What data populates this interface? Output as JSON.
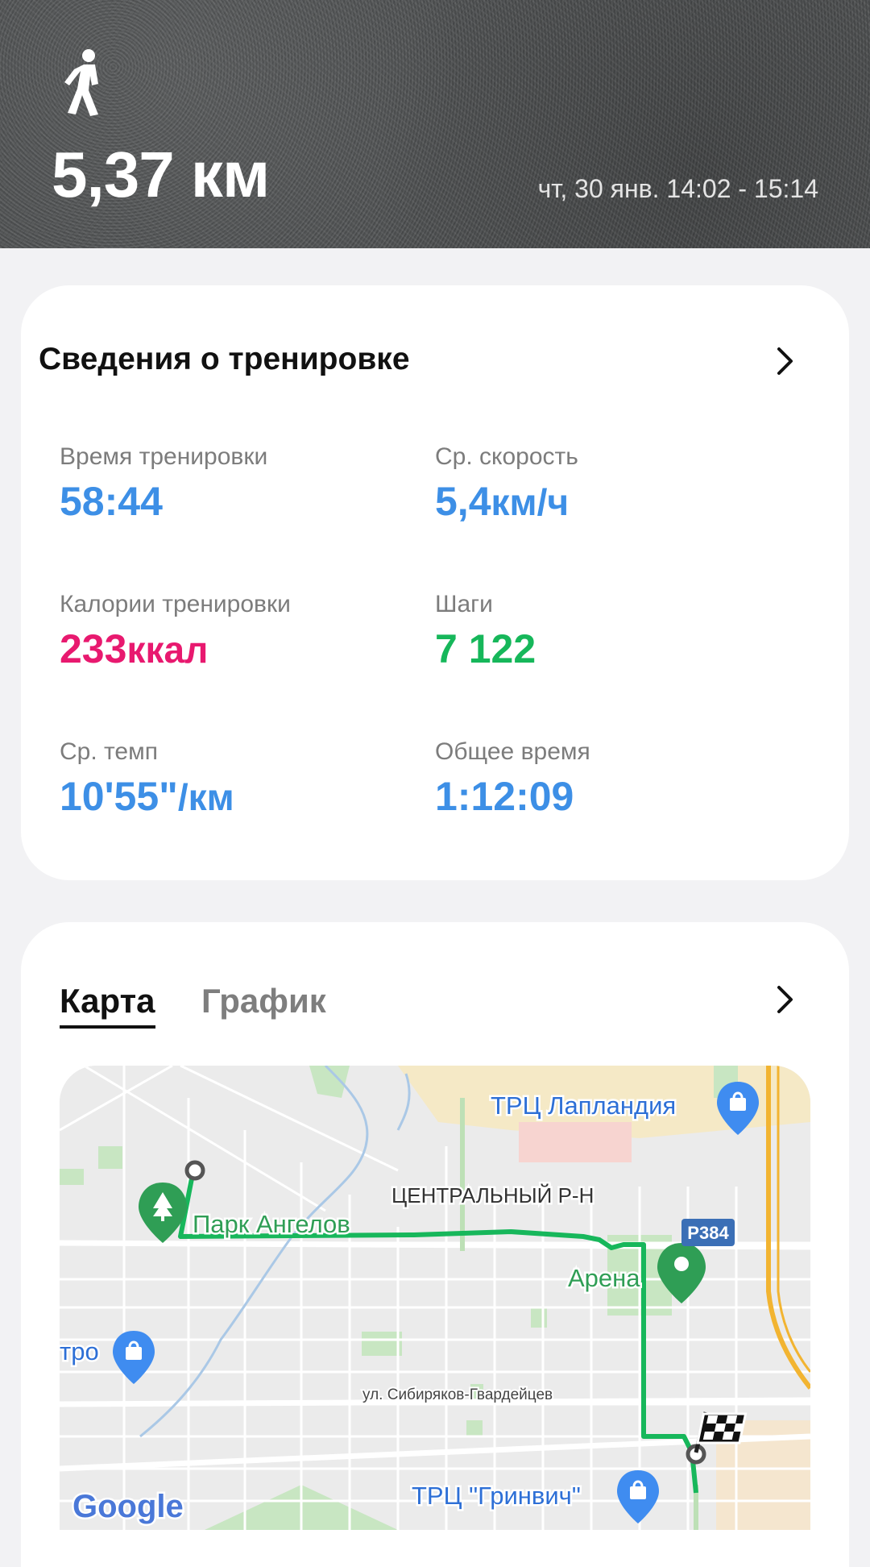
{
  "header": {
    "activity_icon": "walking-person-icon",
    "distance": "5,37 км",
    "datetime": "чт, 30 янв. 14:02 - 15:14"
  },
  "details_card": {
    "title": "Сведения о тренировке",
    "chevron_icon": "chevron-right-icon",
    "stats": [
      {
        "label": "Время тренировки",
        "value": "58:44",
        "unit": "",
        "color": "#3d8fe6"
      },
      {
        "label": "Ср. скорость",
        "value": "5,4",
        "unit": "км/ч",
        "color": "#3d8fe6"
      },
      {
        "label": "Калории тренировки",
        "value": "233",
        "unit": "ккал",
        "color": "#e8196f"
      },
      {
        "label": "Шаги",
        "value": "7 122",
        "unit": "",
        "color": "#16b75a"
      },
      {
        "label": "Ср. темп",
        "value": "10'55\"",
        "unit": "/км",
        "color": "#3d8fe6"
      },
      {
        "label": "Общее время",
        "value": "1:12:09",
        "unit": "",
        "color": "#3d8fe6"
      }
    ]
  },
  "map_card": {
    "tabs": [
      {
        "label": "Карта",
        "active": true
      },
      {
        "label": "График",
        "active": false
      }
    ],
    "chevron_icon": "chevron-right-icon",
    "map": {
      "labels": {
        "mall1": "ТРЦ Лапландия",
        "district": "ЦЕНТРАЛЬНЫЙ Р-Н",
        "park": "Парк Ангелов",
        "road": "Р384",
        "arena": "Арена",
        "tro": "тро",
        "street": "ул. Сибиряков-Гвардейцев",
        "mall2": "ТРЦ \"Гринвич\"",
        "attribution": "Google"
      },
      "route_color": "#17b75b"
    }
  }
}
